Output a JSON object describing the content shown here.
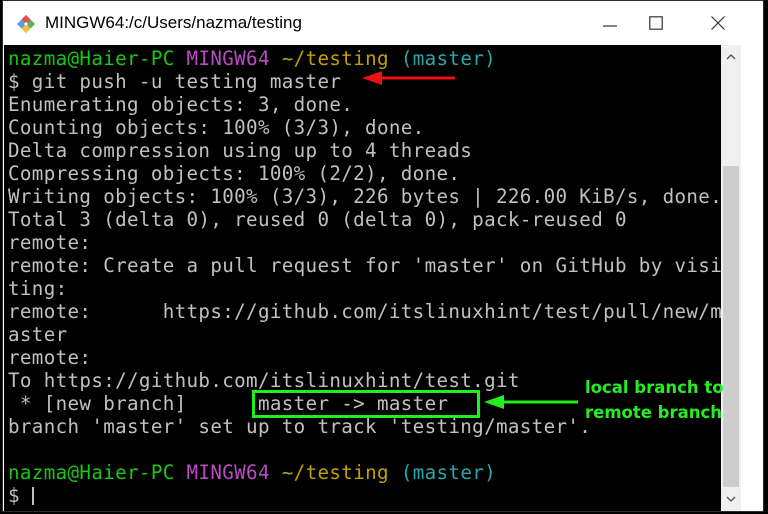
{
  "window": {
    "title": "MINGW64:/c/Users/nazma/testing",
    "icon": "git-bash-icon",
    "controls": {
      "minimize": "minimize-icon",
      "maximize": "maximize-icon",
      "close": "close-icon"
    }
  },
  "prompt1": {
    "user": "nazma@Haier-PC",
    "host": "MINGW64",
    "path": "~/testing",
    "branch": "(master)"
  },
  "command": "$ git push -u testing master",
  "output": [
    "Enumerating objects: 3, done.",
    "Counting objects: 100% (3/3), done.",
    "Delta compression using up to 4 threads",
    "Compressing objects: 100% (2/2), done.",
    "Writing objects: 100% (3/3), 226 bytes | 226.00 KiB/s, done.",
    "Total 3 (delta 0), reused 0 (delta 0), pack-reused 0",
    "remote:",
    "remote: Create a pull request for 'master' on GitHub by visi",
    "ting:",
    "remote:      https://github.com/itslinuxhint/test/pull/new/m",
    "aster",
    "remote:",
    "To https://github.com/itslinuxhint/test.git",
    " * [new branch]      master -> master",
    "branch 'master' set up to track 'testing/master'.",
    ""
  ],
  "prompt2": {
    "user": "nazma@Haier-PC",
    "host": "MINGW64",
    "path": "~/testing",
    "branch": "(master)"
  },
  "input_line": {
    "prefix": "$ ",
    "value": ""
  },
  "scrollbar": {
    "position_fraction": 1.0,
    "visible_fraction": 0.78
  },
  "annotation": {
    "label": "local branch to\nremote branch",
    "color": "#22ee22",
    "arrow_color": "#ee1111"
  },
  "colors": {
    "user": "#18c818",
    "host": "#b84cc0",
    "path": "#c0a000",
    "branch": "#2aa8a8",
    "text": "#c0c0c0",
    "background": "#000000"
  }
}
